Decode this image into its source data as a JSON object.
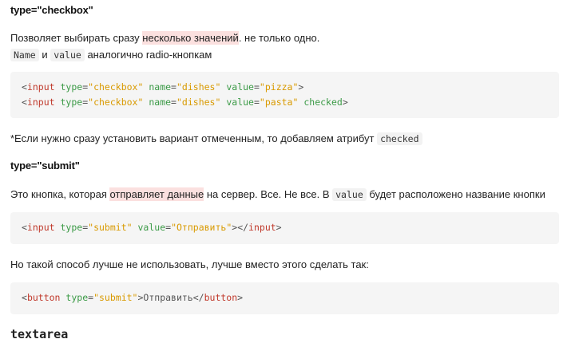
{
  "sec1": {
    "heading": "type=\"checkbox\"",
    "para_start": "Позволяет выбирать сразу ",
    "para_highlight": "несколько значений",
    "para_end": ". не только одно.",
    "line2_code1": "Name",
    "line2_and": " и ",
    "line2_code2": "value",
    "line2_rest": " аналогично radio-кнопкам",
    "code_lines": [
      {
        "tag": "input",
        "type_val": "checkbox",
        "name_val": "dishes",
        "value_val": "pizza",
        "checked": ""
      },
      {
        "tag": "input",
        "type_val": "checkbox",
        "name_val": "dishes",
        "value_val": "pasta",
        "checked": "checked"
      }
    ],
    "note_text": "*Если нужно сразу установить вариант отмеченным, то добавляем атрибут ",
    "note_code": "checked"
  },
  "sec2": {
    "heading": "type=\"submit\"",
    "para_start": "Это кнопка, которая ",
    "para_highlight": "отправляет данные",
    "para_mid": " на сервер. Все. Не все. В ",
    "para_code": "value",
    "para_end": " будет расположено название кнопки",
    "code_input": {
      "tag": "input",
      "type_val": "submit",
      "value_val": "Отправить"
    },
    "para2": "Но такой способ лучше не использовать, лучше вместо этого сделать так:",
    "code_button": {
      "tag": "button",
      "type_val": "submit",
      "text": "Отправить"
    }
  },
  "sec3": {
    "heading": "textarea"
  },
  "tokens": {
    "lt": "<",
    "gt": ">",
    "lt_slash": "</",
    "attr_type": "type",
    "attr_name": "name",
    "attr_value": "value",
    "eq": "=",
    "q": "\""
  }
}
